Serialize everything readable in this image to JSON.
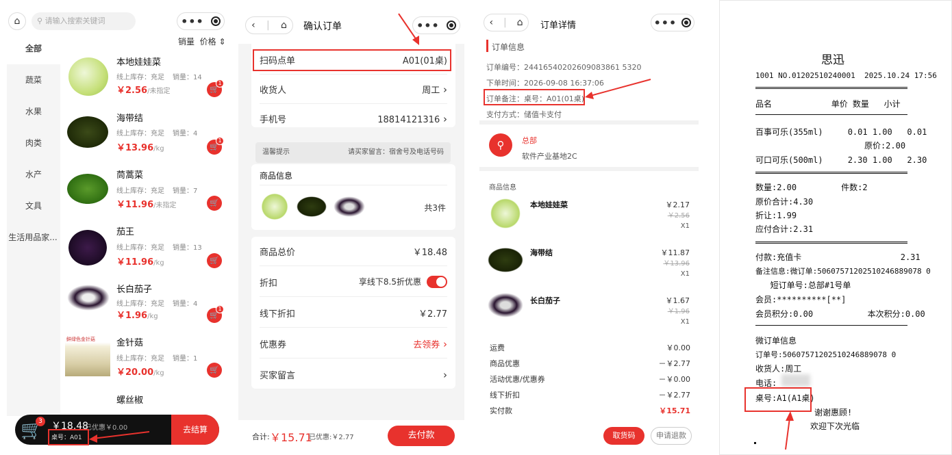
{
  "p1": {
    "search_placeholder": "请输入搜索关键词",
    "sort_sales": "销量",
    "sort_price": "价格 ⇕",
    "categories": [
      "全部",
      "蔬菜",
      "水果",
      "肉类",
      "水产",
      "文具",
      "生活用品家..."
    ],
    "products": [
      {
        "name": "本地娃娃菜",
        "stock": "线上库存：充足",
        "sales": "销量：14",
        "price": "￥2.56",
        "unit": "/未指定",
        "badge": "1"
      },
      {
        "name": "海带结",
        "stock": "线上库存：充足",
        "sales": "销量：4",
        "price": "￥13.96",
        "unit": "/kg",
        "badge": "1"
      },
      {
        "name": "茼蒿菜",
        "stock": "线上库存：充足",
        "sales": "销量：7",
        "price": "￥11.96",
        "unit": "/未指定",
        "badge": ""
      },
      {
        "name": "茄王",
        "stock": "线上库存：充足",
        "sales": "销量：13",
        "price": "￥11.96",
        "unit": "/kg",
        "badge": ""
      },
      {
        "name": "长白茄子",
        "stock": "线上库存：充足",
        "sales": "销量：4",
        "price": "￥1.96",
        "unit": "/kg",
        "badge": "1"
      },
      {
        "name": "金针菇",
        "stock": "线上库存：充足",
        "sales": "销量：1",
        "price": "￥20.00",
        "unit": "/kg",
        "badge": ""
      },
      {
        "name": "螺丝椒",
        "stock": "",
        "sales": "",
        "price": "",
        "unit": "",
        "badge": ""
      }
    ],
    "enoki_pack_label": "鲜绿色金针菇",
    "cart_count": "3",
    "cart_total": "￥18.48",
    "cart_discount": "已优惠￥0.00",
    "table": "桌号：A01",
    "checkout": "去结算"
  },
  "p2": {
    "title": "确认订单",
    "scan_label": "扫码点单",
    "scan_value": "A01(01桌)",
    "receiver_label": "收货人",
    "receiver_value": "周工",
    "phone_label": "手机号",
    "phone_value": "18814121316",
    "tip_label": "温馨提示",
    "tip_value": "请买家留言：宿舍号及电话号码",
    "goods_label": "商品信息",
    "goods_count": "共3件",
    "total_label": "商品总价",
    "total_value": "￥18.48",
    "discount_label": "折扣",
    "discount_value": "享线下8.5折优惠",
    "offline_label": "线下折扣",
    "offline_value": "￥2.77",
    "coupon_label": "优惠券",
    "coupon_value": "去领券",
    "msg_label": "买家留言",
    "sum_label": "合计:",
    "sum_value": "￥15.71",
    "sum_disc": "已优惠:￥2.77",
    "pay": "去付款"
  },
  "p3": {
    "title": "订单详情",
    "section": "订单信息",
    "order_no": "订单编号：24416540202609083861 5320",
    "order_time": "下单时间：2026-09-08 16:37:06",
    "order_note": "订单备注：桌号：A01(01桌)",
    "pay_method": "支付方式：储值卡支付",
    "store": "总部",
    "address": "软件产业基地2C",
    "goods_label": "商品信息",
    "items": [
      {
        "name": "本地娃娃菜",
        "price": "￥2.17",
        "orig": "￥2.56",
        "qty": "X1"
      },
      {
        "name": "海带结",
        "price": "￥11.87",
        "orig": "￥13.96",
        "qty": "X1"
      },
      {
        "name": "长白茄子",
        "price": "￥1.67",
        "orig": "￥1.96",
        "qty": "X1"
      }
    ],
    "summary": [
      {
        "k": "运费",
        "v": "￥0.00"
      },
      {
        "k": "商品优惠",
        "v": "－￥2.77"
      },
      {
        "k": "活动优惠/优惠券",
        "v": "－￥0.00"
      },
      {
        "k": "线下折扣",
        "v": "－￥2.77"
      },
      {
        "k": "实付款",
        "v": "￥15.71"
      }
    ],
    "pickup": "取货码",
    "refund": "申请退款"
  },
  "p4": {
    "shop": "思迅",
    "header": "1001 NO.01202510240001  2025.10.24 17:56",
    "cols": "品名            单价 数量   小计",
    "l1": "百事可乐(355ml)     0.01 1.00   0.01",
    "l2": "                      原价:2.00",
    "l3": "可口可乐(500ml)     2.30 1.00   2.30",
    "l4": "数量:2.00         件数:2",
    "l5": "原价合计:4.30",
    "l6": "折让:1.99",
    "l7": "应付合计:2.31",
    "l8": "付款:充值卡                    2.31",
    "l9": "备注信息:微订单:50607571202510246889078 0",
    "l10": "   短订单号:总部#1号单",
    "l11": "会员:**********[**]",
    "l12": "会员积分:0.00           本次积分:0.00",
    "l13": "微订单信息",
    "l14": "订单号:50607571202510246889078 0",
    "l15": "收货人:周工",
    "l16": "电话:",
    "l17": "桌号:A1(A1桌)",
    "l18": "谢谢惠顾!",
    "l19": "欢迎下次光临"
  }
}
